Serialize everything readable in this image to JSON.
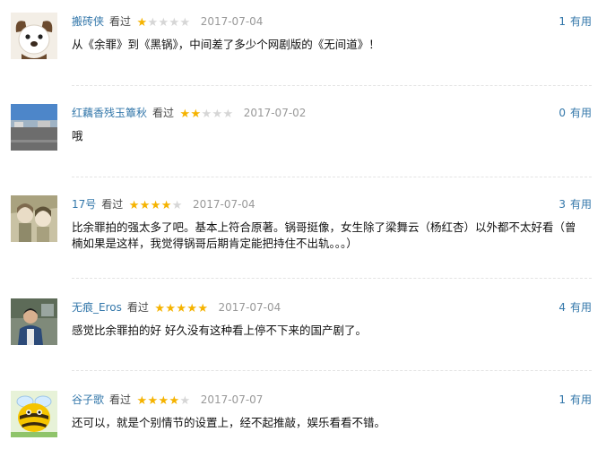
{
  "reviews": [
    {
      "user": "搬砖侠",
      "seen": "看过",
      "rating": 1,
      "date": "2017-07-04",
      "useful_count": "1",
      "useful_label": "有用",
      "text": "从《余罪》到《黑锅》，中间差了多少个网剧版的《无间道》！",
      "avatar": "dog-avatar"
    },
    {
      "user": "红藕香残玉簟秋",
      "seen": "看过",
      "rating": 2,
      "date": "2017-07-02",
      "useful_count": "0",
      "useful_label": "有用",
      "text": "哦",
      "avatar": "street-avatar"
    },
    {
      "user": "17号",
      "seen": "看过",
      "rating": 4,
      "date": "2017-07-04",
      "useful_count": "3",
      "useful_label": "有用",
      "text": "比余罪拍的强太多了吧。基本上符合原著。锅哥挺像，女生除了梁舞云（杨红杏）以外都不太好看（曾楠如果是这样，我觉得锅哥后期肯定能把持住不出轨。。。）",
      "avatar": "anime-avatar"
    },
    {
      "user": "无痕_Eros",
      "seen": "看过",
      "rating": 5,
      "date": "2017-07-04",
      "useful_count": "4",
      "useful_label": "有用",
      "text": "感觉比余罪拍的好 好久没有这种看上停不下来的国产剧了。",
      "avatar": "person-avatar"
    },
    {
      "user": "谷子歌",
      "seen": "看过",
      "rating": 4,
      "date": "2017-07-07",
      "useful_count": "1",
      "useful_label": "有用",
      "text": "还可以，就是个别情节的设置上，经不起推敲，娱乐看看不错。",
      "avatar": "bee-avatar"
    }
  ],
  "colors": {
    "link": "#3377aa",
    "star_on": "#f5b300",
    "star_off": "#d6d6d6",
    "date": "#999999"
  }
}
